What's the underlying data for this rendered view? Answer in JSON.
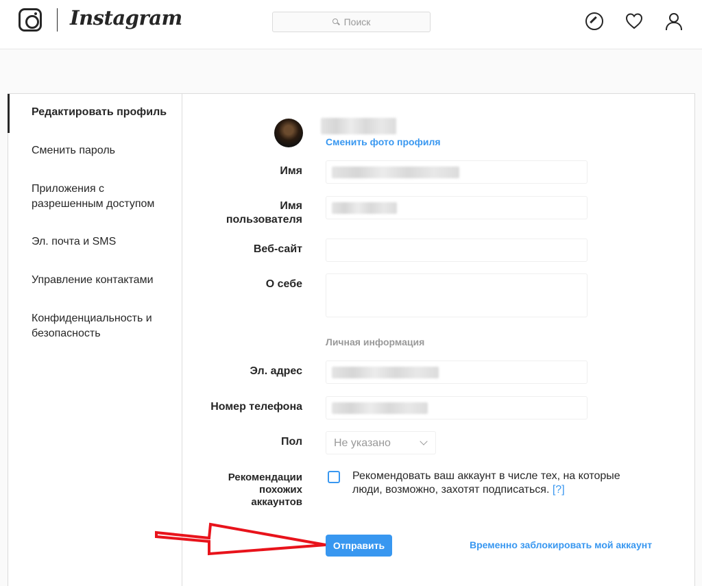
{
  "header": {
    "wordmark": "Instagram",
    "search_placeholder": "Поиск",
    "icons": [
      "compass-icon",
      "heart-icon",
      "profile-icon"
    ]
  },
  "sidebar": {
    "items": [
      {
        "label": "Редактировать профиль",
        "active": true
      },
      {
        "label": "Сменить пароль"
      },
      {
        "label": "Приложения с разрешенным доступом"
      },
      {
        "label": "Эл. почта и SMS"
      },
      {
        "label": "Управление контактами"
      },
      {
        "label": "Конфиденциальность и безопасность"
      }
    ]
  },
  "profile": {
    "change_photo": "Сменить фото профиля"
  },
  "form": {
    "name_label": "Имя",
    "username_label": "Имя пользователя",
    "website_label": "Веб-сайт",
    "bio_label": "О себе",
    "personal_info_title": "Личная информация",
    "email_label": "Эл. адрес",
    "phone_label": "Номер телефона",
    "gender_label": "Пол",
    "gender_value": "Не указано",
    "recommend_label": "Рекомендации похожих аккаунтов",
    "recommend_text": "Рекомендовать ваш аккаунт в числе тех, на которые люди, возможно, захотят подписаться.",
    "recommend_help": "[?]",
    "submit_label": "Отправить",
    "disable_link": "Временно заблокировать мой аккаунт"
  },
  "colors": {
    "accent": "#3897f0",
    "annotation_arrow": "#e8131b"
  }
}
